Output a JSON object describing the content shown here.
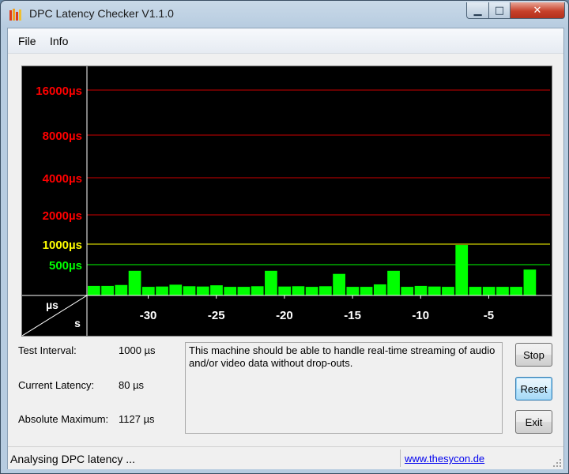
{
  "window": {
    "title": "DPC Latency Checker V1.1.0",
    "controls": {
      "minimize": "▁",
      "maximize": "□",
      "close": "✕"
    }
  },
  "menu": [
    "File",
    "Info"
  ],
  "colors": {
    "graph_bg": "#000000",
    "bar": "#00ff00",
    "red_lines": "#cc0000",
    "yellow_line": "#ffff00",
    "green_line": "#00ff00",
    "red_label": "#ff0000",
    "yellow_label": "#ffff00",
    "green_label": "#00ff00"
  },
  "chart_data": {
    "type": "bar",
    "thresholds": [
      {
        "label": "16000µs",
        "value": 16000,
        "color": "red"
      },
      {
        "label": "8000µs",
        "value": 8000,
        "color": "red"
      },
      {
        "label": "4000µs",
        "value": 4000,
        "color": "red"
      },
      {
        "label": "2000µs",
        "value": 2000,
        "color": "red"
      },
      {
        "label": "1000µs",
        "value": 1000,
        "color": "yellow"
      },
      {
        "label": "500µs",
        "value": 500,
        "color": "green"
      }
    ],
    "x_unit": "s",
    "y_unit": "µs",
    "x_ticks": [
      "-30",
      "-25",
      "-20",
      "-15",
      "-10",
      "-5"
    ],
    "x_tick_values": [
      -30,
      -25,
      -20,
      -15,
      -10,
      -5
    ],
    "x_range": [
      -34,
      -1
    ],
    "values": [
      155,
      155,
      170,
      400,
      140,
      145,
      175,
      150,
      145,
      165,
      140,
      140,
      150,
      400,
      145,
      150,
      140,
      150,
      350,
      140,
      140,
      180,
      400,
      140,
      155,
      145,
      140,
      980,
      140,
      140,
      140,
      140,
      420
    ],
    "bar_x": [
      -34,
      -33,
      -32,
      -31,
      -30,
      -29,
      -28,
      -27,
      -26,
      -25,
      -24,
      -23,
      -22,
      -21,
      -20,
      -19,
      -18,
      -17,
      -16,
      -15,
      -14,
      -13,
      -12,
      -11,
      -10,
      -9,
      -8,
      -7,
      -6,
      -5,
      -4,
      -3,
      -2
    ]
  },
  "info": {
    "test_interval_label": "Test Interval:",
    "test_interval_value": "1000 µs",
    "current_latency_label": "Current Latency:",
    "current_latency_value": "80 µs",
    "absolute_maximum_label": "Absolute Maximum:",
    "absolute_maximum_value": "1127 µs",
    "message": "This machine should be able to handle real-time streaming of audio and/or video data without drop-outs."
  },
  "buttons": {
    "stop": "Stop",
    "reset": "Reset",
    "exit": "Exit"
  },
  "status": {
    "text": "Analysing DPC latency ...",
    "link": "www.thesycon.de"
  }
}
